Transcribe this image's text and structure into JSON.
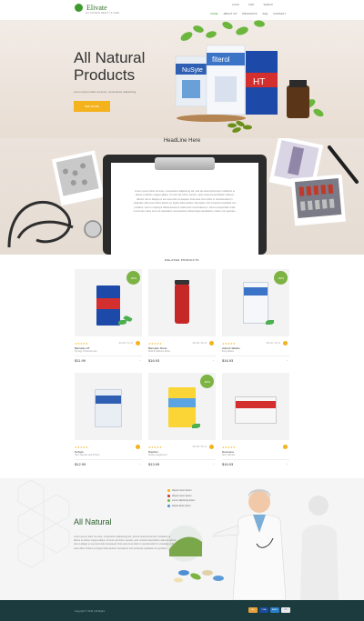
{
  "brand": {
    "name": "Elivate",
    "tagline": "ALL NATURAL BEAUTY & CARE"
  },
  "topbar": {
    "login": "LOGIN",
    "cart": "CART",
    "search": "SEARCH"
  },
  "nav": {
    "items": [
      "HOME",
      "ABOUT US",
      "PRODUCTS",
      "FAQ",
      "CONTACT"
    ]
  },
  "hero": {
    "title": "All Natural Products",
    "subtitle": "Lorem ipsum dolor sit amet, consectetur adipisicing",
    "button": "SEE MORE"
  },
  "headline": {
    "title": "HeadLine Here",
    "text": "Lorem ipsum dolor sit amet, consectetur adipisicing elit, sed do eiusmod tempor incididunt ut labore et dolore magna aliqua. Ut enim ad minim veniam, quis nostrud exercitation ullamco laboris nisi ut aliquip ex ea commodo consequat. Duis aute irure dolor in reprehenderit in voluptate velit esse cillum dolore eu fugiat nulla pariatur. Excepteur sint occaecat cupidatat non proident, sunt in culpa qui officia deserunt mollit anim id est laborum. Sed ut perspiciatis unde omnis iste natus error sit voluptatem accusantium doloremque laudantium, totam rem aperiam."
  },
  "products": {
    "title": "RELATED PRODUCTS",
    "items": [
      {
        "name": "Barnacle HT",
        "desc": "Hiy Agy. Protection diet",
        "price": "$11.99",
        "old": "$14.99 / $1.14",
        "badge": "-30%"
      },
      {
        "name": "Barnacle Shots",
        "desc": "Multi B Vitamins Shots",
        "price": "$16.93",
        "old": "$19.90 / $2.14",
        "badge": ""
      },
      {
        "name": "Adrenil Tablets",
        "desc": "Drug tablets",
        "price": "$16.93",
        "old": "$19.20 / $3.14",
        "badge": "-30%"
      },
      {
        "name": "NuSyte",
        "desc": "Skin Vitamins and Protein",
        "price": "$12.99",
        "old": "",
        "badge": ""
      },
      {
        "name": "DieuSol",
        "desc": "Dietary supplement",
        "price": "$13.99",
        "old": "$16.99 / $1.14",
        "badge": "-60%"
      },
      {
        "name": "Newmera",
        "desc": "Skin Vitamins",
        "price": "$16.93",
        "old": "",
        "badge": ""
      }
    ]
  },
  "natural": {
    "title": "All Natural",
    "text": "Lorem ipsum dolor sit amet, consectetur adipisicing elit, sed do eiusmod tempor incididunt ut labore et dolore magna aliqua. Ut enim ad minim veniam, quis nostrud exercitation ullamco laboris nisi ut aliquip ex ea commodo consequat. Duis aute irure dolor in reprehenderit in voluptate velit esse cillum dolore eu fugiat nulla pariatur. Excepteur sint occaecat cupidatat non proident.",
    "legend": [
      "Aliquis Lorem Ipsum",
      "Aliquis Lorem Ipsum",
      "Lorem adipiscing Ipsum",
      "Aliquis Dolor Ipsum"
    ]
  },
  "footer": {
    "copyright": "Copyright © 2016 | All Rights",
    "payments": [
      "MC",
      "VISA",
      "AMEX",
      "PP"
    ]
  },
  "colors": {
    "accent": "#3f9a2e",
    "button": "#f4b21c",
    "footer": "#1b3b3e",
    "badge": "#7cb342"
  }
}
